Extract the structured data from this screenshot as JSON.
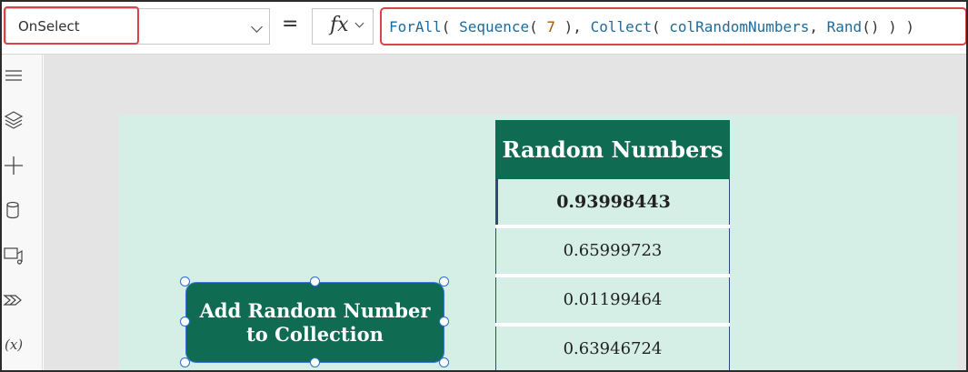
{
  "formula_bar": {
    "property": "OnSelect",
    "equals_sign": "=",
    "fx_label": "fx",
    "formula": {
      "fn_forall": "ForAll",
      "open1": "( ",
      "fn_sequence": "Sequence",
      "open2": "( ",
      "count": "7",
      "close2": " ), ",
      "fn_collect": "Collect",
      "open3": "( ",
      "collection": "colRandomNumbers",
      "comma": ", ",
      "fn_rand": "Rand",
      "tail": "() ) )"
    }
  },
  "left_rail": {
    "icons": [
      "hamburger-menu-icon",
      "layers-icon",
      "insert-plus-icon",
      "data-cylinder-icon",
      "media-icon",
      "power-automate-icon",
      "variables-icon"
    ],
    "variables_label": "(x)"
  },
  "canvas": {
    "background_color": "#d5eee6",
    "accent_color": "#0f6b52",
    "gallery": {
      "header": "Random Numbers",
      "rows": [
        "0.93998443",
        "0.65999723",
        "0.01199464",
        "0.63946724"
      ]
    },
    "button": {
      "line1": "Add Random Number",
      "line2": "to Collection"
    }
  }
}
